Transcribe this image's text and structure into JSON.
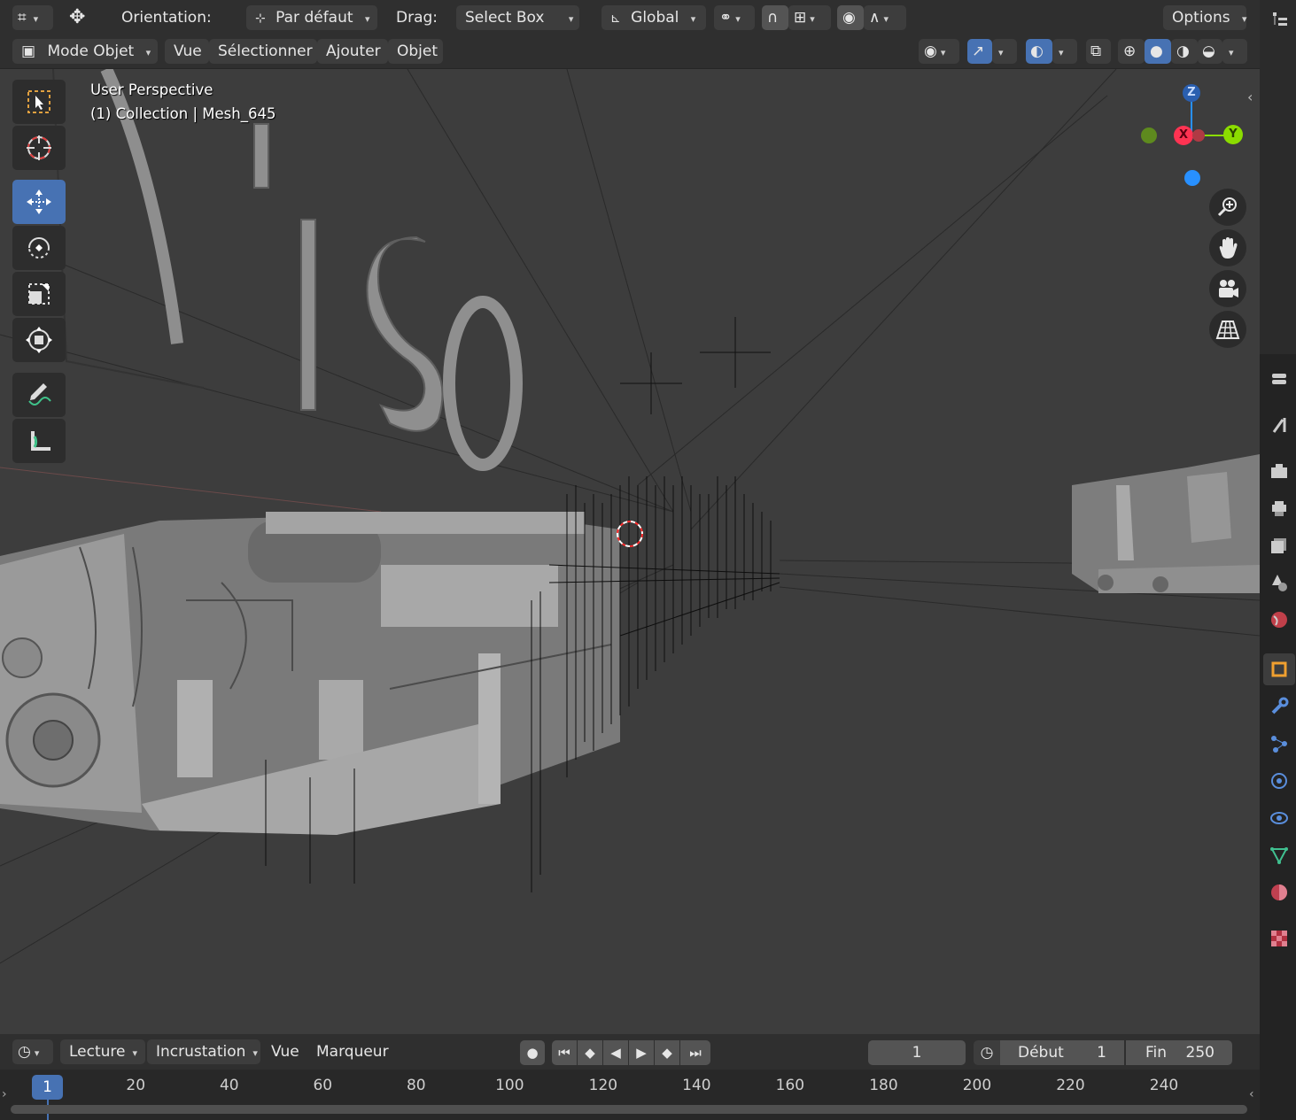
{
  "header": {
    "orientation_label": "Orientation:",
    "orientation_value": "Par défaut",
    "drag_label": "Drag:",
    "drag_value": "Select Box",
    "transform_space": "Global",
    "options_label": "Options",
    "mode": "Mode Objet",
    "menu": [
      "Vue",
      "Sélectionner",
      "Ajouter",
      "Objet"
    ]
  },
  "viewport": {
    "view_name": "User Perspective",
    "collection_info": "(1) Collection | Mesh_645",
    "gizmo": {
      "z": "Z",
      "x": "X",
      "y": "Y"
    }
  },
  "timeline": {
    "menu": [
      "Lecture",
      "Incrustation",
      "Vue",
      "Marqueur"
    ],
    "current_frame": "1",
    "start_label": "Début",
    "start_value": "1",
    "end_label": "Fin",
    "end_value": "250",
    "ruler_current": "1",
    "ruler_ticks": [
      "20",
      "40",
      "60",
      "80",
      "100",
      "120",
      "140",
      "160",
      "180",
      "200",
      "220",
      "240"
    ]
  },
  "colors": {
    "accent": "#4772b3",
    "axis_x": "#ff3352",
    "axis_y": "#8bdc00",
    "axis_z": "#2890ff"
  }
}
